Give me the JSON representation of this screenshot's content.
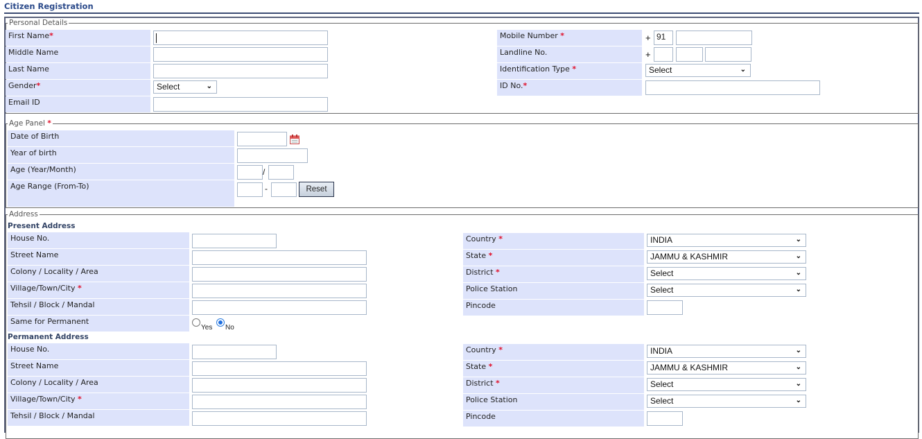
{
  "page": {
    "title": "Citizen Registration"
  },
  "personal": {
    "legend": "Personal Details",
    "first_name": {
      "label": "First Name",
      "required": "*",
      "value": ""
    },
    "middle_name": {
      "label": "Middle Name",
      "value": ""
    },
    "last_name": {
      "label": "Last Name",
      "value": ""
    },
    "gender": {
      "label": "Gender",
      "required": "*",
      "selected": "Select"
    },
    "email": {
      "label": "Email ID",
      "value": ""
    },
    "mobile": {
      "label": "Mobile Number",
      "required": "*",
      "prefix": "+",
      "country_code": "91",
      "number": ""
    },
    "landline": {
      "label": "Landline No.",
      "prefix": "+",
      "part1": "",
      "part2": "",
      "part3": ""
    },
    "id_type": {
      "label": "Identification Type",
      "required": "*",
      "selected": "Select"
    },
    "id_no": {
      "label": "ID No.",
      "required": "*",
      "value": ""
    }
  },
  "age": {
    "legend": "Age Panel",
    "required": "*",
    "dob": {
      "label": "Date of Birth",
      "value": "",
      "icon": "calendar-icon"
    },
    "yob": {
      "label": "Year of birth",
      "value": ""
    },
    "age_ym": {
      "label": "Age (Year/Month)",
      "separator": "/",
      "years": "",
      "months": ""
    },
    "age_range": {
      "label": "Age Range (From-To)",
      "separator": "-",
      "from": "",
      "to": ""
    },
    "reset_label": "Reset"
  },
  "address": {
    "legend": "Address",
    "present": {
      "heading": "Present Address",
      "house_no": {
        "label": "House No.",
        "value": ""
      },
      "street": {
        "label": "Street Name",
        "value": ""
      },
      "colony": {
        "label": "Colony / Locality / Area",
        "value": ""
      },
      "village": {
        "label": "Village/Town/City",
        "required": "*",
        "value": ""
      },
      "tehsil": {
        "label": "Tehsil / Block / Mandal",
        "value": ""
      },
      "same_for_permanent": {
        "label": "Same for Permanent",
        "options": [
          "Yes",
          "No"
        ],
        "selected": "No"
      },
      "country": {
        "label": "Country",
        "required": "*",
        "selected": "INDIA"
      },
      "state": {
        "label": "State",
        "required": "*",
        "selected": "JAMMU & KASHMIR"
      },
      "district": {
        "label": "District",
        "required": "*",
        "selected": "Select"
      },
      "police_station": {
        "label": "Police Station",
        "selected": "Select"
      },
      "pincode": {
        "label": "Pincode",
        "value": ""
      }
    },
    "permanent": {
      "heading": "Permanent Address",
      "house_no": {
        "label": "House No.",
        "value": ""
      },
      "street": {
        "label": "Street Name",
        "value": ""
      },
      "colony": {
        "label": "Colony / Locality / Area",
        "value": ""
      },
      "village": {
        "label": "Village/Town/City",
        "required": "*",
        "value": ""
      },
      "tehsil": {
        "label": "Tehsil / Block / Mandal",
        "value": ""
      },
      "country": {
        "label": "Country",
        "required": "*",
        "selected": "INDIA"
      },
      "state": {
        "label": "State",
        "required": "*",
        "selected": "JAMMU & KASHMIR"
      },
      "district": {
        "label": "District",
        "required": "*",
        "selected": "Select"
      },
      "police_station": {
        "label": "Police Station",
        "selected": "Select"
      },
      "pincode": {
        "label": "Pincode",
        "value": ""
      }
    }
  },
  "icons": {
    "dropdown": "chevron-down-icon",
    "calendar": "calendar-icon"
  },
  "colors": {
    "label_bg": "#dde3fb",
    "title": "#2b4a8a",
    "required": "#e0102a",
    "radio_checked": "#1f6fe0"
  }
}
